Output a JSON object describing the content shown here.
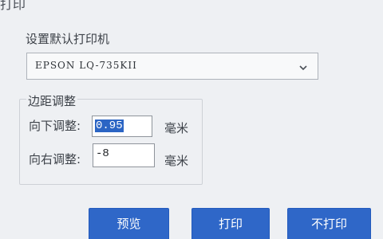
{
  "window": {
    "title": "打印"
  },
  "printer": {
    "label": "设置默认打印机",
    "selected": "EPSON LQ-735KII"
  },
  "margins": {
    "group_label": "边距调整",
    "down": {
      "label": "向下调整:",
      "value": "0.95",
      "unit": "毫米"
    },
    "right": {
      "label": "向右调整:",
      "value": "-8",
      "unit": "毫米"
    }
  },
  "buttons": {
    "preview": "预览",
    "print": "打印",
    "no_print": "不打印"
  },
  "colors": {
    "button": "#2f67c8",
    "selection": "#2b65c4"
  },
  "icons": {
    "dropdown": "chevron-down-icon"
  }
}
